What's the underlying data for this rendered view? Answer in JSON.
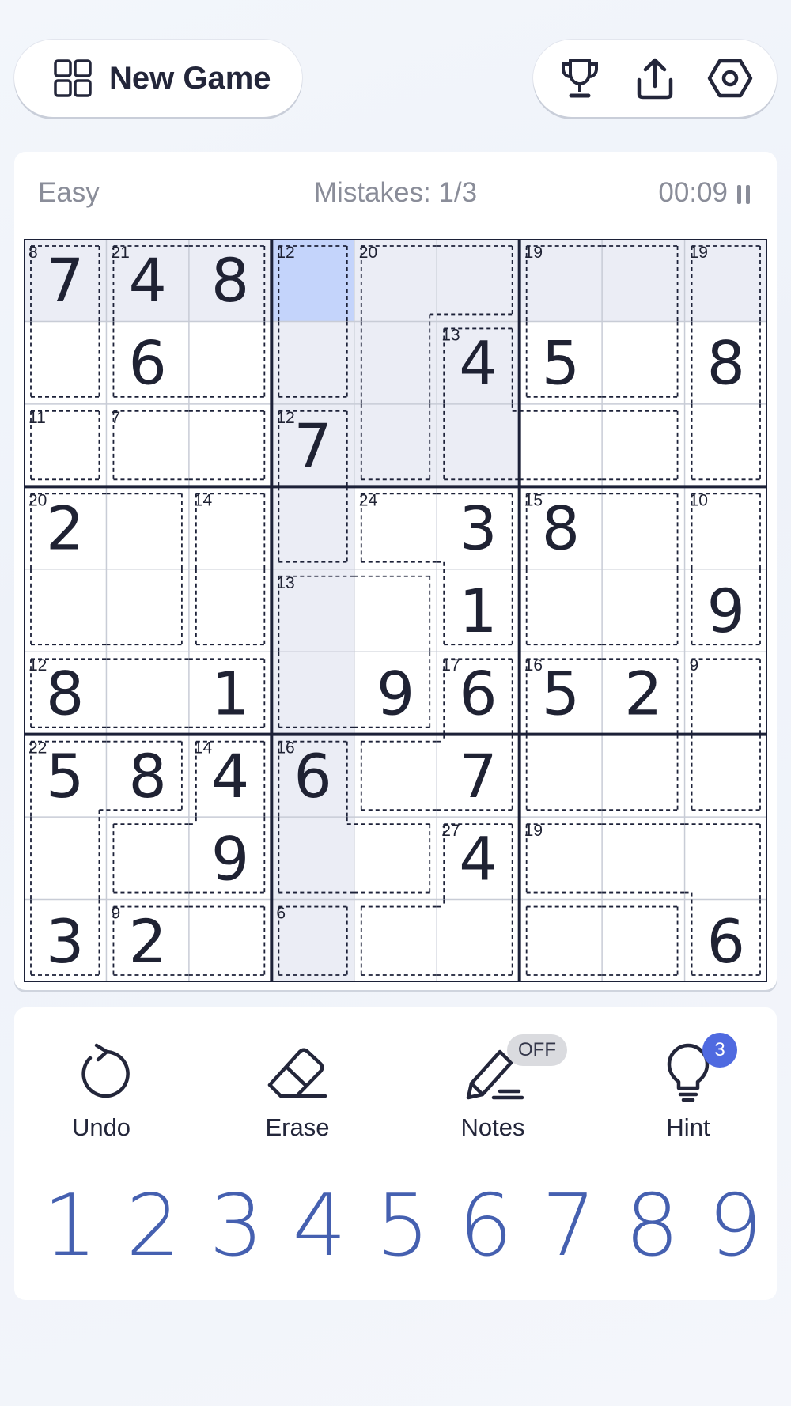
{
  "header": {
    "new_game_label": "New Game",
    "new_game_icon": "grid-icon",
    "tools": [
      {
        "name": "trophy-button",
        "icon": "trophy-icon"
      },
      {
        "name": "share-button",
        "icon": "share-icon"
      },
      {
        "name": "settings-button",
        "icon": "gear-icon"
      }
    ]
  },
  "status": {
    "difficulty": "Easy",
    "mistakes": "Mistakes: 1/3",
    "timer": "00:09",
    "pause_icon": "pause-icon"
  },
  "board": {
    "values": [
      "748......",
      ".6...45.8",
      "...7.....",
      "2....38..",
      ".....1..9",
      "8.1.9652.",
      "5846.7...",
      "..9..4...",
      "32......6"
    ],
    "cages": [
      {
        "sum": "8",
        "cells": [
          [
            0,
            0
          ],
          [
            1,
            0
          ]
        ]
      },
      {
        "sum": "21",
        "cells": [
          [
            0,
            1
          ],
          [
            0,
            2
          ],
          [
            1,
            1
          ],
          [
            1,
            2
          ]
        ]
      },
      {
        "sum": "12",
        "cells": [
          [
            0,
            3
          ],
          [
            1,
            3
          ]
        ]
      },
      {
        "sum": "20",
        "cells": [
          [
            0,
            4
          ],
          [
            0,
            5
          ],
          [
            1,
            4
          ],
          [
            2,
            4
          ]
        ]
      },
      {
        "sum": "19",
        "cells": [
          [
            0,
            6
          ],
          [
            0,
            7
          ],
          [
            1,
            6
          ],
          [
            1,
            7
          ]
        ]
      },
      {
        "sum": "19",
        "cells": [
          [
            0,
            8
          ],
          [
            1,
            8
          ],
          [
            2,
            8
          ]
        ]
      },
      {
        "sum": "13",
        "cells": [
          [
            1,
            5
          ],
          [
            2,
            5
          ],
          [
            2,
            6
          ],
          [
            2,
            7
          ]
        ]
      },
      {
        "sum": "11",
        "cells": [
          [
            2,
            0
          ]
        ]
      },
      {
        "sum": "7",
        "cells": [
          [
            2,
            1
          ],
          [
            2,
            2
          ]
        ]
      },
      {
        "sum": "12",
        "cells": [
          [
            2,
            3
          ],
          [
            3,
            3
          ]
        ]
      },
      {
        "sum": "20",
        "cells": [
          [
            3,
            0
          ],
          [
            3,
            1
          ],
          [
            4,
            1
          ],
          [
            4,
            0
          ]
        ]
      },
      {
        "sum": "14",
        "cells": [
          [
            3,
            2
          ],
          [
            4,
            2
          ]
        ]
      },
      {
        "sum": "24",
        "cells": [
          [
            3,
            4
          ],
          [
            3,
            5
          ],
          [
            4,
            5
          ]
        ]
      },
      {
        "sum": "15",
        "cells": [
          [
            3,
            6
          ],
          [
            3,
            7
          ],
          [
            4,
            6
          ],
          [
            4,
            7
          ]
        ]
      },
      {
        "sum": "10",
        "cells": [
          [
            3,
            8
          ],
          [
            4,
            8
          ]
        ]
      },
      {
        "sum": "12",
        "cells": [
          [
            5,
            0
          ],
          [
            5,
            1
          ],
          [
            5,
            2
          ]
        ]
      },
      {
        "sum": "13",
        "cells": [
          [
            5,
            3
          ],
          [
            5,
            4
          ],
          [
            4,
            3
          ],
          [
            4,
            4
          ]
        ]
      },
      {
        "sum": "17",
        "cells": [
          [
            5,
            5
          ],
          [
            6,
            5
          ],
          [
            6,
            4
          ]
        ]
      },
      {
        "sum": "16",
        "cells": [
          [
            5,
            6
          ],
          [
            5,
            7
          ],
          [
            6,
            6
          ],
          [
            6,
            7
          ]
        ]
      },
      {
        "sum": "9",
        "cells": [
          [
            5,
            8
          ],
          [
            6,
            8
          ]
        ]
      },
      {
        "sum": "22",
        "cells": [
          [
            6,
            0
          ],
          [
            7,
            0
          ],
          [
            8,
            0
          ],
          [
            6,
            1
          ]
        ]
      },
      {
        "sum": "14",
        "cells": [
          [
            6,
            2
          ],
          [
            7,
            1
          ],
          [
            7,
            2
          ]
        ]
      },
      {
        "sum": "16",
        "cells": [
          [
            6,
            3
          ],
          [
            7,
            3
          ],
          [
            7,
            4
          ]
        ]
      },
      {
        "sum": "27",
        "cells": [
          [
            7,
            5
          ],
          [
            8,
            5
          ],
          [
            8,
            4
          ]
        ]
      },
      {
        "sum": "19",
        "cells": [
          [
            7,
            6
          ],
          [
            7,
            7
          ],
          [
            7,
            8
          ],
          [
            8,
            8
          ]
        ]
      },
      {
        "sum": "9",
        "cells": [
          [
            8,
            1
          ],
          [
            8,
            2
          ]
        ]
      },
      {
        "sum": "6",
        "cells": [
          [
            8,
            3
          ]
        ]
      },
      {
        "sum": "",
        "cells": [
          [
            8,
            6
          ],
          [
            8,
            7
          ]
        ]
      }
    ],
    "selected": [
      0,
      3
    ],
    "colors": {
      "selected": "#c4d4fb",
      "highlight": "#ebedf5",
      "thick_line": "#1c2138",
      "thin_line": "#c8ccd6",
      "cage_line": "#1c2138",
      "digit": "#1f2233"
    }
  },
  "controls": {
    "undo": {
      "label": "Undo",
      "icon": "undo-icon"
    },
    "erase": {
      "label": "Erase",
      "icon": "eraser-icon"
    },
    "notes": {
      "label": "Notes",
      "icon": "pencil-icon",
      "state": "OFF"
    },
    "hint": {
      "label": "Hint",
      "icon": "lightbulb-icon",
      "count": "3"
    }
  },
  "numpad": [
    "1",
    "2",
    "3",
    "4",
    "5",
    "6",
    "7",
    "8",
    "9"
  ],
  "accent_color": "#4560b0"
}
